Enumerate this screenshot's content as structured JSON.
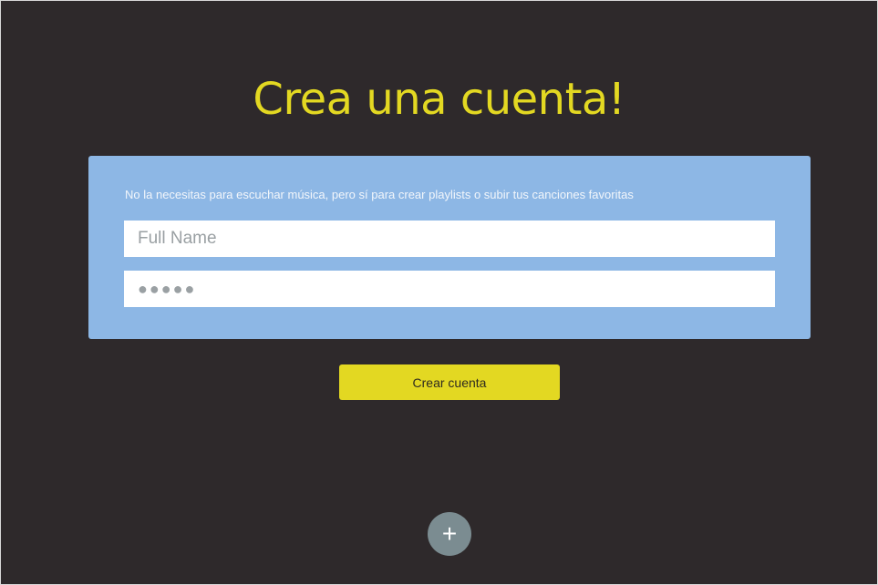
{
  "header": {
    "title": "Crea una cuenta!"
  },
  "form": {
    "description": "No la necesitas para escuchar música, pero sí para crear playlists o subir tus canciones favoritas",
    "name_placeholder": "Full Name",
    "password_value": "●●●●●",
    "submit_label": "Crear cuenta"
  },
  "fab": {
    "icon": "plus-icon",
    "glyph": "+"
  },
  "colors": {
    "accent": "#e3d822",
    "card": "#8db7e5",
    "background": "#2e292b",
    "fab": "#7b8c91"
  }
}
